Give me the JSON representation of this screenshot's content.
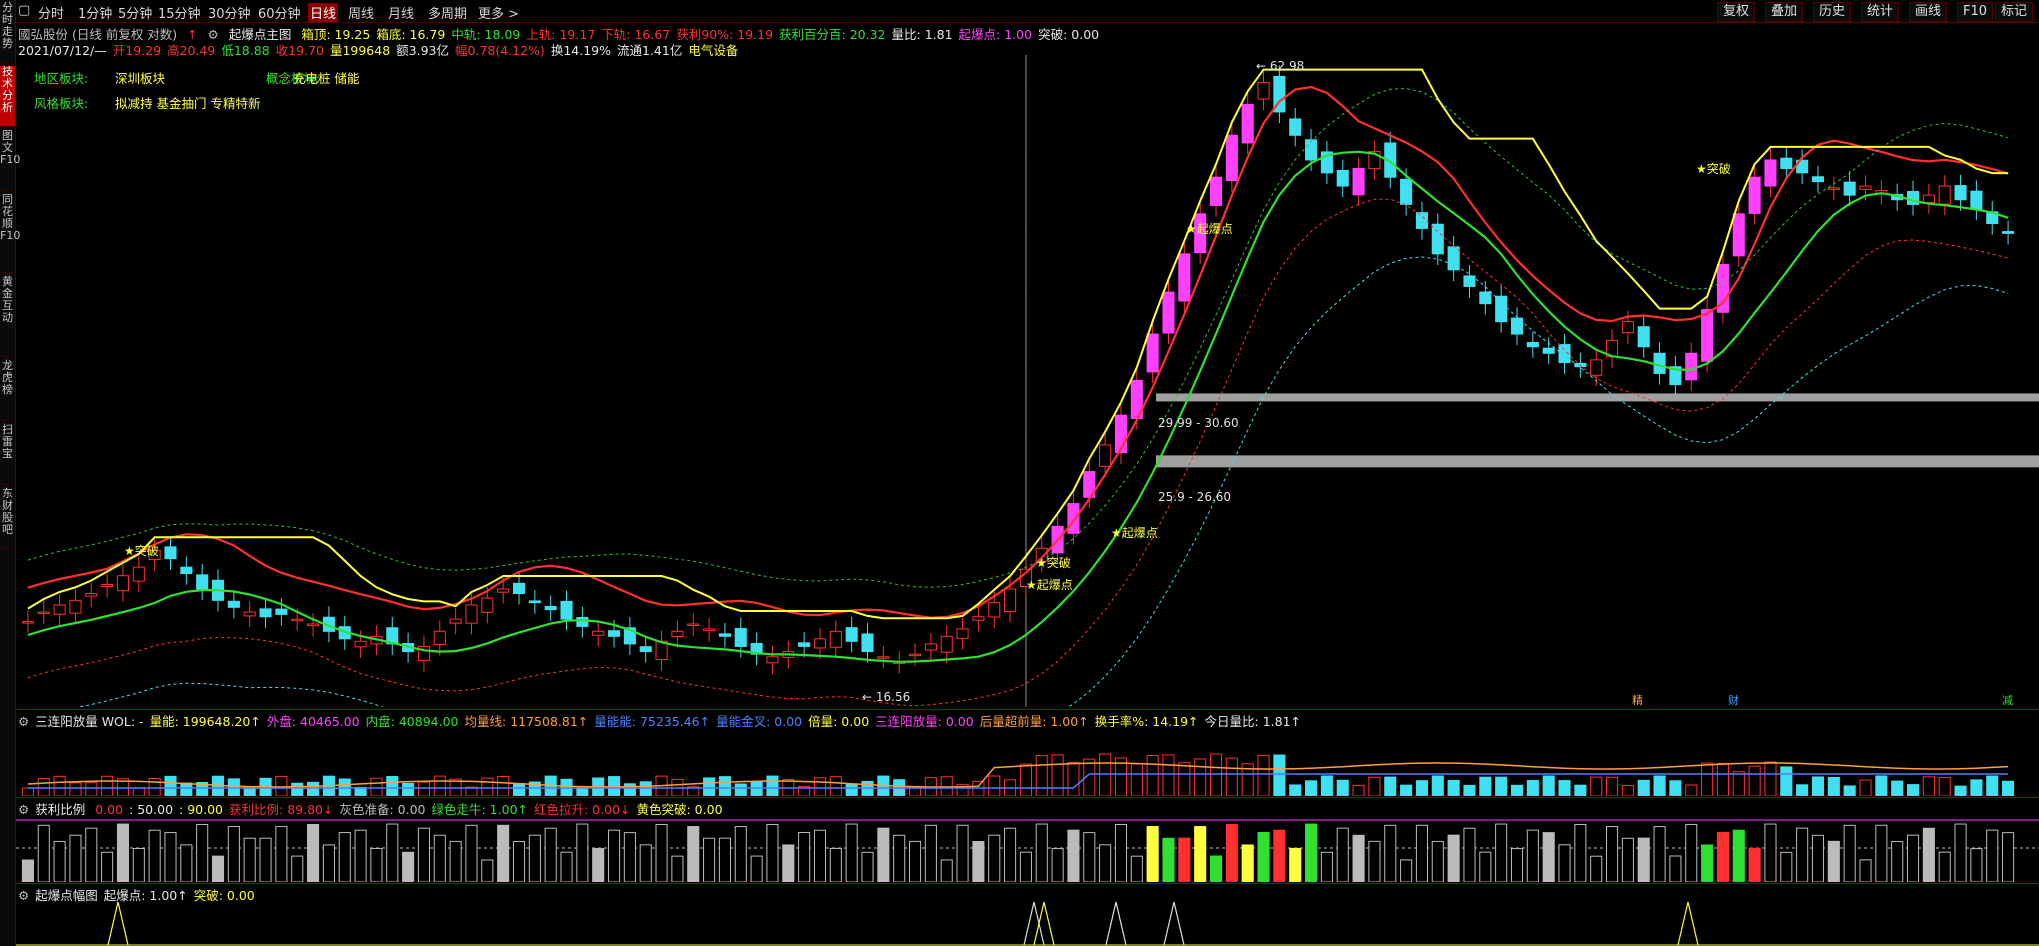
{
  "side_tabs": [
    "分时走势",
    "技术分析",
    "图文F10",
    "同花顺F10",
    "黄金互动",
    "龙虎榜",
    "扫雷宝",
    "东财股吧"
  ],
  "toolbar": {
    "period_tabs": [
      "分时",
      "1分钟",
      "5分钟",
      "15分钟",
      "30分钟",
      "60分钟",
      "日线",
      "周线",
      "月线",
      "多周期",
      "更多"
    ],
    "active_period": "日线",
    "right_buttons": [
      "复权",
      "叠加",
      "历史",
      "统计",
      "画线",
      "F10",
      "标记"
    ]
  },
  "info_line": {
    "stock": "國弘股份 (日线 前复权 对数)",
    "indicator": "起爆点主图",
    "items": [
      {
        "label": "箱顶:",
        "value": "19.25",
        "color": "#ffff40"
      },
      {
        "label": "箱底:",
        "value": "16.79",
        "color": "#ffff40"
      },
      {
        "label": "中轨:",
        "value": "18.09",
        "color": "#30e030"
      },
      {
        "label": "上轨:",
        "value": "19.17",
        "color": "#ff3030"
      },
      {
        "label": "下轨:",
        "value": "16.67",
        "color": "#ff3030"
      },
      {
        "label": "获利90%:",
        "value": "19.19",
        "color": "#ff3030"
      },
      {
        "label": "获利百分百:",
        "value": "20.32",
        "color": "#30e030"
      },
      {
        "label": "量比:",
        "value": "1.81",
        "color": "#e8e8e8"
      },
      {
        "label": "起爆点:",
        "value": "1.00",
        "color": "#ff40ff"
      },
      {
        "label": "突破:",
        "value": "0.00",
        "color": "#e8e8e8"
      }
    ]
  },
  "quote_line": {
    "date": "2021/07/12/—",
    "open": "开19.29",
    "high": "高20.49",
    "low": "低18.88",
    "close": "收19.70",
    "volume": "量199648",
    "amount": "额3.93亿",
    "change": "幅0.78(4.12%)",
    "turnover": "换14.19%",
    "float": "流通1.41亿",
    "sector": "电气设备"
  },
  "sectors": {
    "region_label": "地区板块:",
    "region_value": "深圳板块",
    "concept_label": "概念板块:",
    "concept_value": "充电桩 储能",
    "style_label": "风格板块:",
    "style_value": "拟减持 基金抽门 专精特新"
  },
  "price_labels": {
    "high": "62.98",
    "low": "16.56",
    "band1": "29.99 - 30.60",
    "band2": "25.9 - 26.60"
  },
  "markers": {
    "breakout": "★突破",
    "detonate": "★起爆点",
    "event_jing": "精",
    "event_cai": "财",
    "event_jian": "减"
  },
  "vol_pane": {
    "items": [
      {
        "label": "三连阳放量 WOL:",
        "value": "-",
        "color": "#e8e8e8"
      },
      {
        "label": "量能:",
        "value": "199648.20↑",
        "color": "#ffff40"
      },
      {
        "label": "外盘:",
        "value": "40465.00",
        "color": "#ff40ff"
      },
      {
        "label": "内盘:",
        "value": "40894.00",
        "color": "#30e030"
      },
      {
        "label": "均量线:",
        "value": "117508.81↑",
        "color": "#ffa040"
      },
      {
        "label": "量能能:",
        "value": "75235.46↑",
        "color": "#5080ff"
      },
      {
        "label": "量能金叉:",
        "value": "0.00",
        "color": "#5080ff"
      },
      {
        "label": "倍量:",
        "value": "0.00",
        "color": "#ffff40"
      },
      {
        "label": "三连阳放量:",
        "value": "0.00",
        "color": "#ff40ff"
      },
      {
        "label": "后量超前量:",
        "value": "1.00↑",
        "color": "#ffa040"
      },
      {
        "label": "换手率%:",
        "value": "14.19↑",
        "color": "#ffff40"
      },
      {
        "label": "今日量比:",
        "value": "1.81↑",
        "color": "#e8e8e8"
      }
    ]
  },
  "profit_pane": {
    "items": [
      {
        "label": "获利比例",
        "value": "",
        "color": "#e8e8e8"
      },
      {
        "label": "",
        "value": "0.00",
        "color": "#ff3030"
      },
      {
        "label": ":",
        "value": "50.00",
        "color": "#e8e8e8"
      },
      {
        "label": ":",
        "value": "90.00",
        "color": "#ffff40"
      },
      {
        "label": "获利比例:",
        "value": "89.80↓",
        "color": "#ff3030"
      },
      {
        "label": "灰色准备:",
        "value": "0.00",
        "color": "#bdbdbd"
      },
      {
        "label": "绿色走牛:",
        "value": "1.00↑",
        "color": "#30e030"
      },
      {
        "label": "红色拉升:",
        "value": "0.00↓",
        "color": "#ff3030"
      },
      {
        "label": "黄色突破:",
        "value": "0.00",
        "color": "#ffff40"
      }
    ]
  },
  "burst_pane": {
    "items": [
      {
        "label": "起爆点幅图",
        "value": "",
        "color": "#e8e8e8"
      },
      {
        "label": "起爆点:",
        "value": "1.00↑",
        "color": "#e8e8e8"
      },
      {
        "label": "突破:",
        "value": "0.00",
        "color": "#ffff40"
      }
    ]
  },
  "colors": {
    "up": "#ff3030",
    "down": "#40e0f0",
    "mid": "#30e030",
    "box": "#ffff40",
    "accent": "#ff40ff"
  },
  "chart_data": {
    "type": "candlestick",
    "close_series": [
      18.2,
      18.6,
      18.9,
      19.1,
      19.4,
      19.8,
      20.2,
      20.6,
      21.4,
      21.0,
      20.3,
      19.6,
      19.1,
      18.8,
      18.6,
      18.4,
      18.5,
      18.3,
      18.1,
      17.8,
      17.5,
      17.4,
      17.6,
      17.3,
      17.0,
      17.2,
      17.8,
      18.3,
      18.9,
      19.2,
      19.6,
      19.4,
      19.0,
      18.7,
      18.3,
      18.0,
      17.8,
      17.6,
      17.3,
      17.0,
      17.4,
      17.8,
      18.1,
      17.9,
      17.6,
      17.2,
      16.9,
      16.8,
      17.0,
      17.2,
      17.5,
      17.8,
      17.4,
      17.0,
      16.8,
      16.6,
      16.9,
      17.3,
      17.6,
      17.9,
      18.4,
      19.0,
      19.6,
      20.5,
      21.5,
      22.6,
      23.8,
      25.6,
      27.2,
      29.1,
      31.5,
      35.0,
      38.5,
      42.0,
      46.0,
      50.0,
      55.0,
      59.0,
      62.0,
      58.0,
      55.0,
      52.0,
      50.5,
      49.0,
      51.0,
      53.0,
      50.0,
      47.0,
      44.5,
      42.0,
      40.5,
      39.0,
      37.5,
      36.0,
      35.0,
      34.0,
      33.5,
      32.8,
      32.5,
      33.0,
      34.5,
      36.0,
      34.0,
      32.0,
      31.2,
      33.5,
      37.0,
      41.0,
      46.0,
      50.0,
      52.0,
      51.0,
      50.5,
      49.5,
      48.8,
      48.0,
      49.0,
      48.5,
      47.5,
      47.0,
      48.0,
      49.0,
      47.5,
      46.5,
      45.0,
      44.0
    ],
    "price_high": 62.98,
    "price_low": 16.56
  }
}
